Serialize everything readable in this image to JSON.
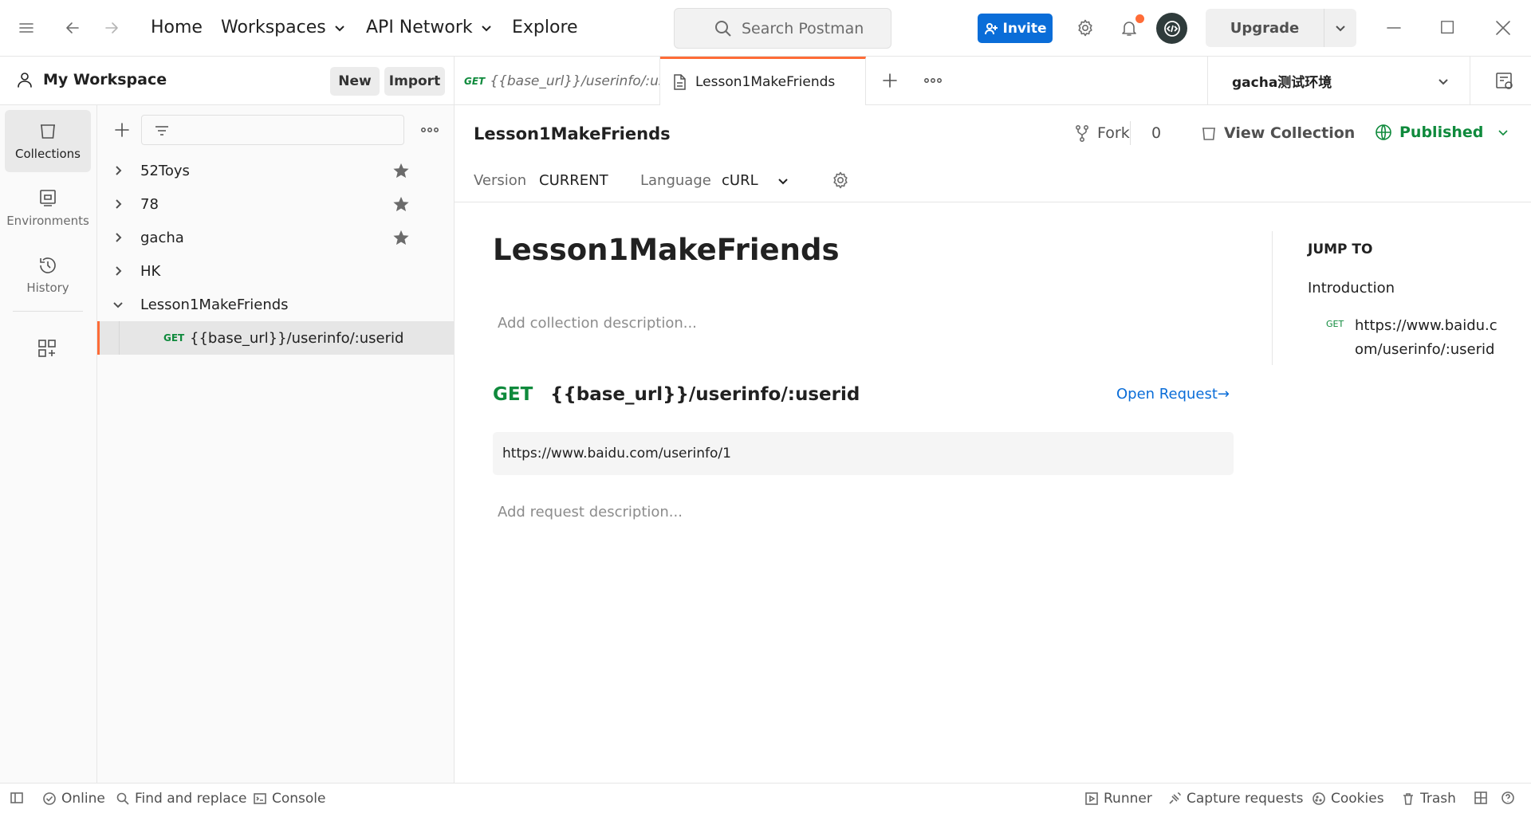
{
  "header": {
    "nav": {
      "home": "Home",
      "workspaces": "Workspaces",
      "api_network": "API Network",
      "explore": "Explore"
    },
    "search_placeholder": "Search Postman",
    "invite_label": "Invite",
    "upgrade_label": "Upgrade",
    "notification_dot_color": "#ff6c37",
    "brand_color": "#0a6dd8"
  },
  "workspace": {
    "title": "My Workspace",
    "new_label": "New",
    "import_label": "Import"
  },
  "rail": {
    "collections": "Collections",
    "environments": "Environments",
    "history": "History"
  },
  "collections": {
    "items": [
      {
        "label": "52Toys",
        "starred": true,
        "expanded": false
      },
      {
        "label": "78",
        "starred": true,
        "expanded": false
      },
      {
        "label": "gacha",
        "starred": true,
        "expanded": false
      },
      {
        "label": "HK",
        "starred": false,
        "expanded": false
      },
      {
        "label": "Lesson1MakeFriends",
        "starred": false,
        "expanded": true
      }
    ],
    "request": {
      "method": "GET",
      "label": "{{base_url}}/userinfo/:userid"
    }
  },
  "tabs": [
    {
      "method": "GET",
      "label": "{{base_url}}/userinfo/:use"
    },
    {
      "label": "Lesson1MakeFriends"
    }
  ],
  "environment": "gacha测试环境",
  "collection_header": {
    "name": "Lesson1MakeFriends",
    "fork_label": "Fork",
    "fork_count": "0",
    "view_collection_label": "View Collection",
    "published_label": "Published",
    "version_label": "Version",
    "version_value": "CURRENT",
    "language_label": "Language",
    "language_value": "cURL"
  },
  "doc": {
    "title": "Lesson1MakeFriends",
    "collection_description_placeholder": "Add collection description...",
    "request": {
      "method": "GET",
      "title": "{{base_url}}/userinfo/:userid",
      "open_request": "Open Request→",
      "url": "https://www.baidu.com/userinfo/1",
      "description_placeholder": "Add request description..."
    }
  },
  "jump_to": {
    "title": "JUMP TO",
    "introduction": "Introduction",
    "item_method": "GET",
    "item_link": "https://www.baidu.com/userinfo/:userid"
  },
  "statusbar": {
    "online": "Online",
    "find_replace": "Find and replace",
    "console": "Console",
    "runner": "Runner",
    "capture": "Capture requests",
    "cookies": "Cookies",
    "trash": "Trash"
  }
}
